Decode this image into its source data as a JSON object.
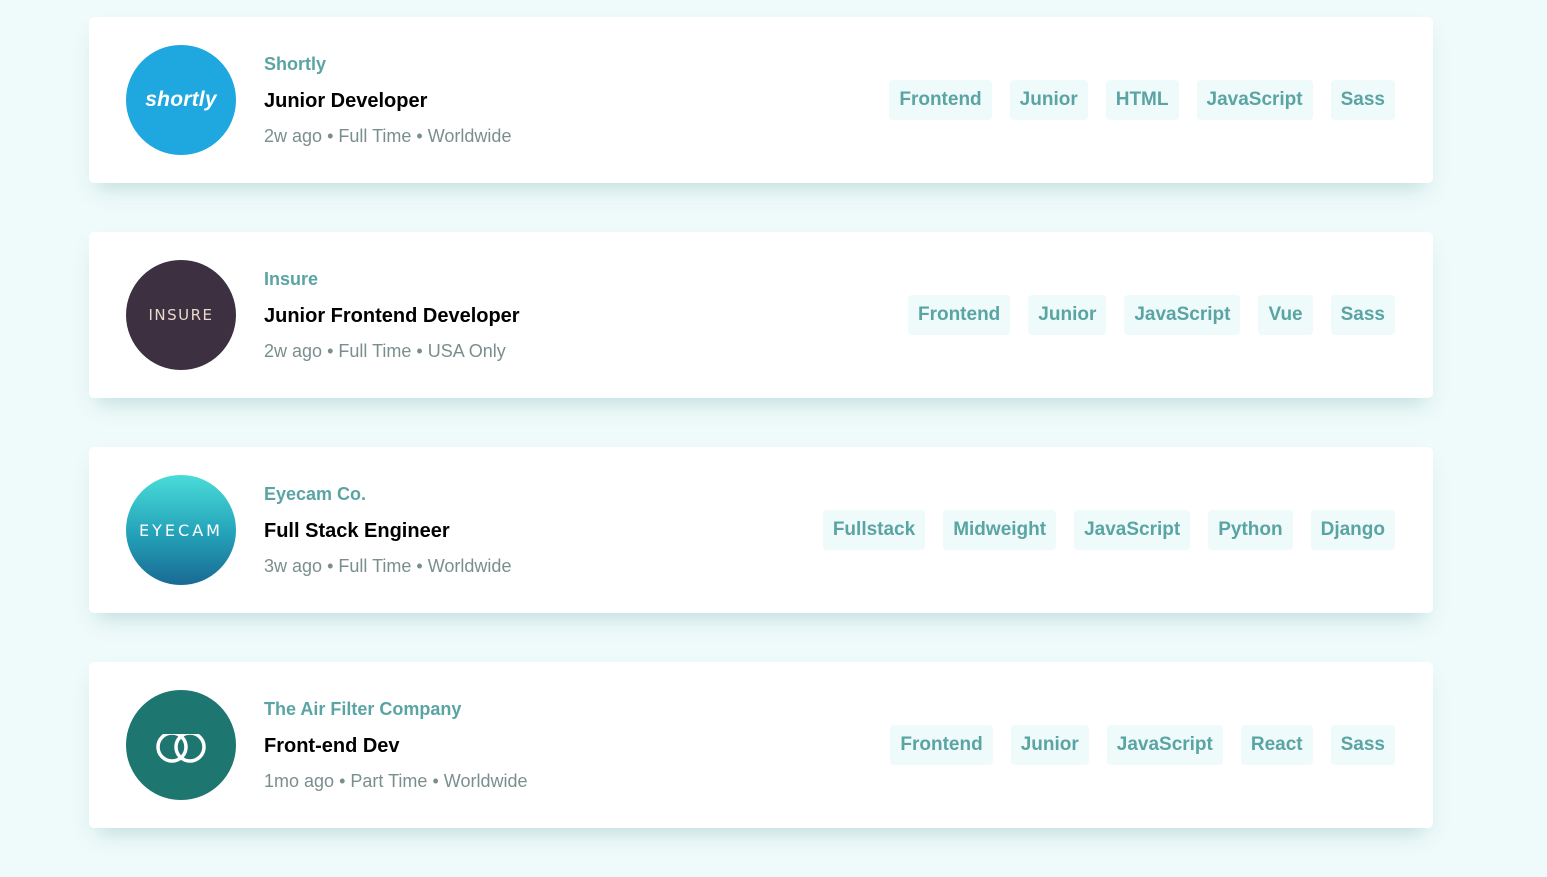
{
  "jobs": [
    {
      "company": "Shortly",
      "logo_text": "shortly",
      "position": "Junior Developer",
      "posted": "2w ago",
      "contract": "Full Time",
      "location": "Worldwide",
      "tags": [
        "Frontend",
        "Junior",
        "HTML",
        "JavaScript",
        "Sass"
      ]
    },
    {
      "company": "Insure",
      "logo_text": "INSURE",
      "position": "Junior Frontend Developer",
      "posted": "2w ago",
      "contract": "Full Time",
      "location": "USA Only",
      "tags": [
        "Frontend",
        "Junior",
        "JavaScript",
        "Vue",
        "Sass"
      ]
    },
    {
      "company": "Eyecam Co.",
      "logo_text": "EYECAM",
      "position": "Full Stack Engineer",
      "posted": "3w ago",
      "contract": "Full Time",
      "location": "Worldwide",
      "tags": [
        "Fullstack",
        "Midweight",
        "JavaScript",
        "Python",
        "Django"
      ]
    },
    {
      "company": "The Air Filter Company",
      "logo_text": "",
      "position": "Front-end Dev",
      "posted": "1mo ago",
      "contract": "Part Time",
      "location": "Worldwide",
      "tags": [
        "Frontend",
        "Junior",
        "JavaScript",
        "React",
        "Sass"
      ]
    }
  ],
  "separator": "•",
  "colors": {
    "background": "#effafa",
    "accent": "#5ba4a4",
    "meta_text": "#7b8e8e",
    "shortly_logo": "#1fa7df",
    "insure_logo": "#3d3040",
    "air_filter_logo": "#1e7670"
  }
}
